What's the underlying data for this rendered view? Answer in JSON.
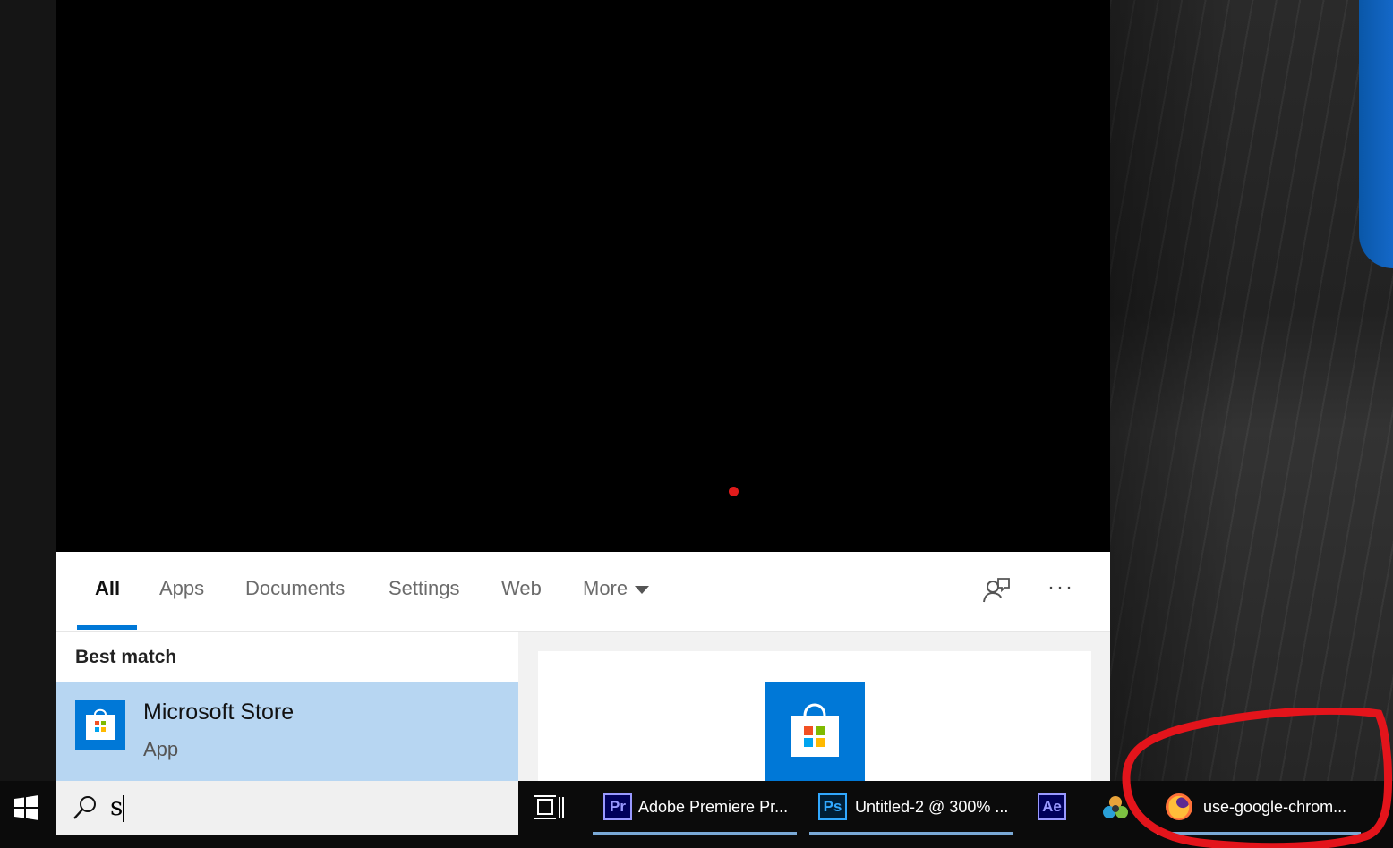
{
  "search_panel": {
    "tabs": [
      {
        "label": "All",
        "active": true
      },
      {
        "label": "Apps"
      },
      {
        "label": "Documents"
      },
      {
        "label": "Settings"
      },
      {
        "label": "Web"
      },
      {
        "label": "More"
      }
    ],
    "more_options_label": "···",
    "best_match_label": "Best match",
    "result": {
      "title": "Microsoft Store",
      "subtitle": "App",
      "icon": "microsoft-store-icon"
    }
  },
  "taskbar": {
    "search_value": "s",
    "apps": [
      {
        "badge": "Pr",
        "label": "Adobe Premiere Pr...",
        "color": "#9999ff",
        "bg": "#00005b"
      },
      {
        "badge": "Ps",
        "label": "Untitled-2 @ 300% ...",
        "color": "#31a8ff",
        "bg": "#001e36"
      },
      {
        "badge": "Ae",
        "label": "",
        "color": "#9999ff",
        "bg": "#00005b"
      },
      {
        "badge": "",
        "label": "use-google-chrom...",
        "icon": "firefox-icon"
      }
    ]
  },
  "colors": {
    "accent": "#0078d7",
    "selection": "#b7d6f2",
    "annotation": "#e3141b"
  }
}
